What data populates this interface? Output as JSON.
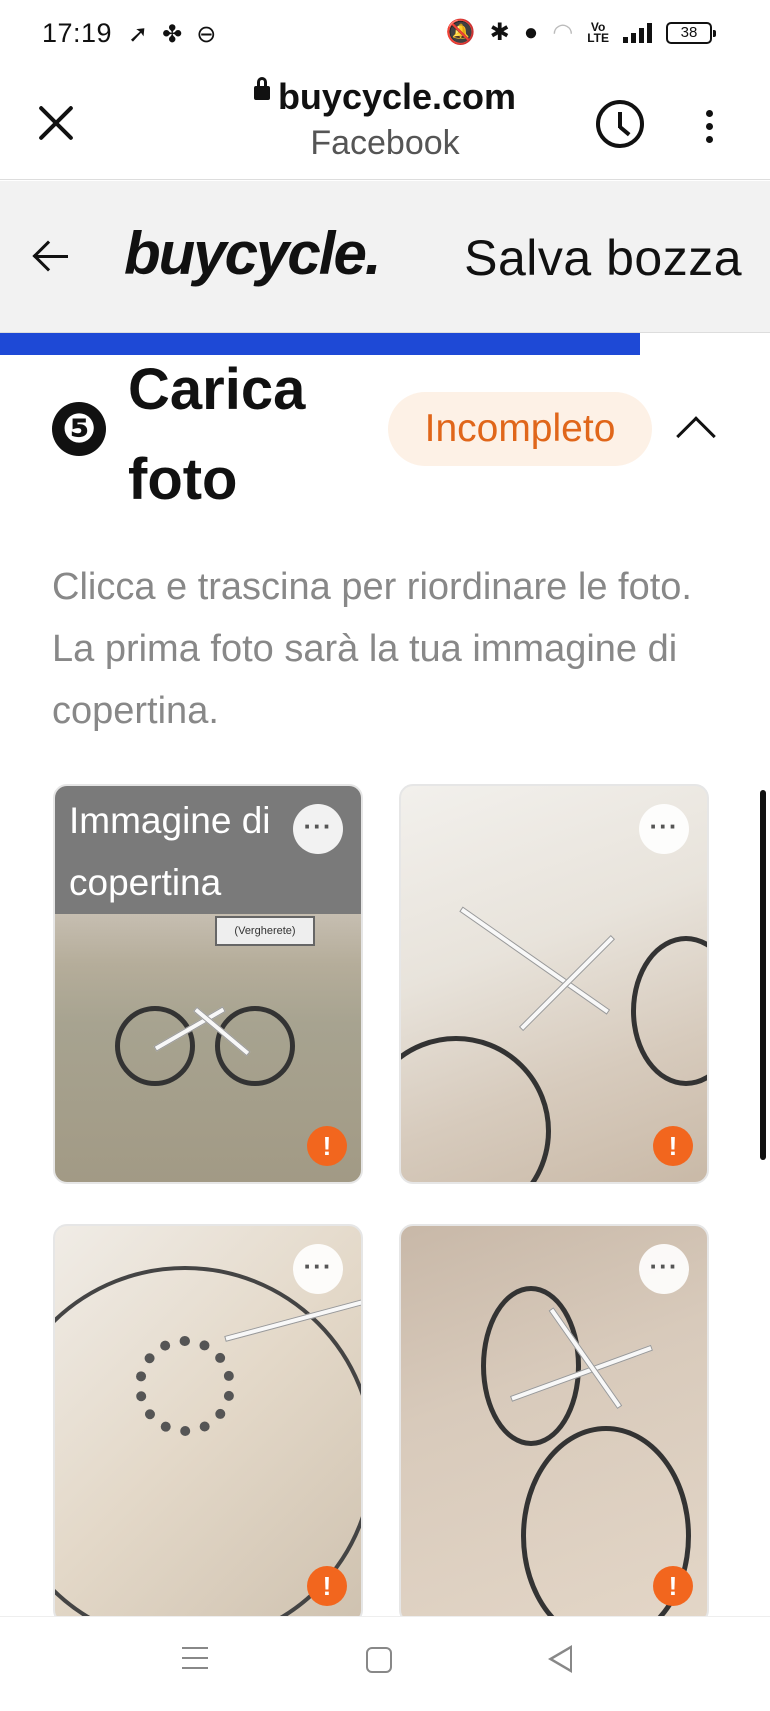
{
  "status_bar": {
    "time": "17:19",
    "battery": "38",
    "left_icons": [
      "navigation-icon",
      "fan-icon",
      "link-icon"
    ],
    "right_icons": [
      "mute-icon",
      "bluetooth-icon",
      "location-icon",
      "wifi-icon",
      "volte-icon",
      "signal-icon",
      "battery-icon"
    ]
  },
  "browser": {
    "url": "buycycle.com",
    "subtitle": "Facebook"
  },
  "app_header": {
    "logo": "buycycle.",
    "save_draft": "Salva bozza"
  },
  "progress": {
    "value_fraction": 0.83
  },
  "step": {
    "number": "❺",
    "title": "Carica foto",
    "status": "Incompleto",
    "status_color": "#e0661a",
    "accent": "#1e49d6"
  },
  "help_text": "Clicca e trascina per riordinare le foto. La prima foto sarà la tua immagine di copertina.",
  "photos": [
    {
      "cover_label": "Immagine di copertina",
      "more": "···",
      "warning": "!"
    },
    {
      "more": "···",
      "warning": "!"
    },
    {
      "more": "···",
      "warning": "!"
    },
    {
      "more": "···",
      "warning": "!"
    }
  ],
  "warning_color": "#f2661e"
}
